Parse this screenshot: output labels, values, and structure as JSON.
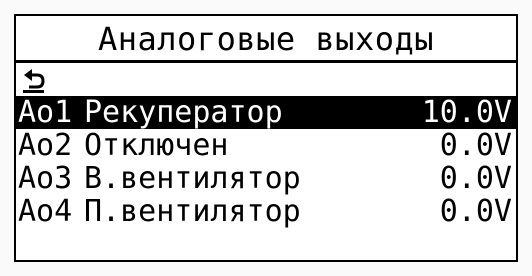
{
  "screen": {
    "title": "Аналоговые выходы",
    "back_icon": "return-arrow-icon"
  },
  "outputs": [
    {
      "id": "Ao1",
      "name": "Рекуператор",
      "value": "10.0V",
      "selected": true
    },
    {
      "id": "Ao2",
      "name": "Отключен",
      "value": "0.0V",
      "selected": false
    },
    {
      "id": "Ao3",
      "name": "В.вентилятор",
      "value": "0.0V",
      "selected": false
    },
    {
      "id": "Ao4",
      "name": "П.вентилятор",
      "value": "0.0V",
      "selected": false
    }
  ],
  "colors": {
    "background": "#ffffff",
    "foreground": "#000000",
    "selection_bg": "#000000",
    "selection_fg": "#ffffff"
  }
}
